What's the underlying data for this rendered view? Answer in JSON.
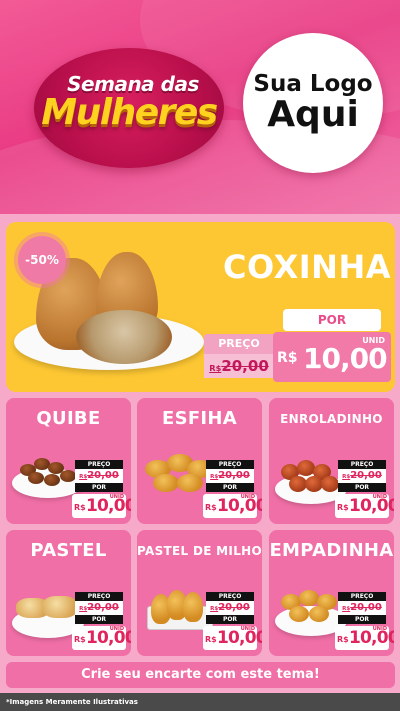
{
  "header": {
    "title_line1": "Semana das",
    "title_line2": "Mulheres",
    "logo_line1": "Sua Logo",
    "logo_line2": "Aqui"
  },
  "featured": {
    "discount": "-50%",
    "name": "COXINHA",
    "por_label": "POR",
    "preco_label": "PREÇO",
    "old_currency": "R$",
    "old_price": "20,00",
    "currency": "R$",
    "new_price": "10,00",
    "unit": "UNID"
  },
  "products": [
    {
      "name": "QUIBE",
      "preco_label": "PREÇO",
      "old_currency": "R$",
      "old_price": "20,00",
      "por_label": "POR",
      "currency": "R$",
      "new_price": "10,00",
      "unit": "UNID"
    },
    {
      "name": "ESFIHA",
      "preco_label": "PREÇO",
      "old_currency": "R$",
      "old_price": "20,00",
      "por_label": "POR",
      "currency": "R$",
      "new_price": "10,00",
      "unit": "UNID"
    },
    {
      "name": "ENROLADINHO",
      "preco_label": "PREÇO",
      "old_currency": "R$",
      "old_price": "20,00",
      "por_label": "POR",
      "currency": "R$",
      "new_price": "10,00",
      "unit": "UNID"
    },
    {
      "name": "PASTEL",
      "preco_label": "PREÇO",
      "old_currency": "R$",
      "old_price": "20,00",
      "por_label": "POR",
      "currency": "R$",
      "new_price": "10,00",
      "unit": "UNID"
    },
    {
      "name": "PASTEL DE MILHO",
      "preco_label": "PREÇO",
      "old_currency": "R$",
      "old_price": "20,00",
      "por_label": "POR",
      "currency": "R$",
      "new_price": "10,00",
      "unit": "UNID"
    },
    {
      "name": "EMPADINHA",
      "preco_label": "PREÇO",
      "old_currency": "R$",
      "old_price": "20,00",
      "por_label": "POR",
      "currency": "R$",
      "new_price": "10,00",
      "unit": "UNID"
    }
  ],
  "cta": "Crie seu encarte com este tema!",
  "footer": "*Imagens Meramente Ilustrativas",
  "colors": {
    "header_pink": "#e93a83",
    "card_pink": "#f06fa6",
    "featured_yellow": "#fdc733",
    "title_gold": "#ffd21f",
    "price_red": "#e0245e"
  }
}
